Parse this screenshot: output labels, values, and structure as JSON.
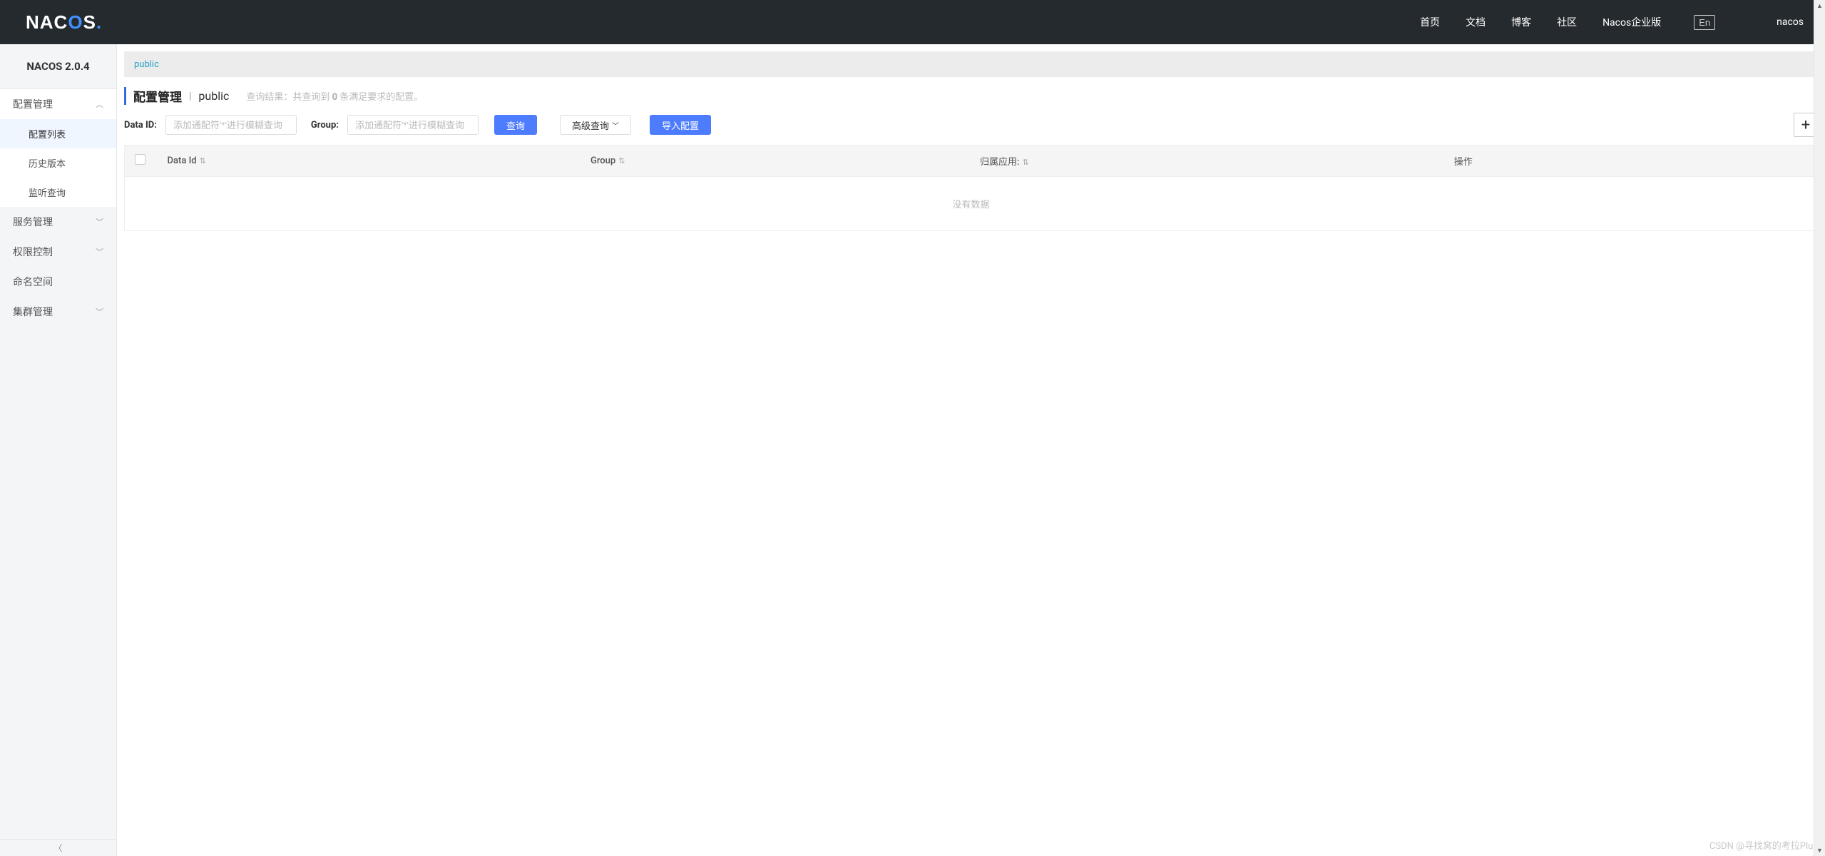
{
  "header": {
    "logo_text_1": "NAC",
    "logo_text_2": "O",
    "logo_text_3": "S",
    "nav": [
      "首页",
      "文档",
      "博客",
      "社区",
      "Nacos企业版"
    ],
    "lang": "En",
    "user": "nacos"
  },
  "sidebar": {
    "title": "NACOS 2.0.4",
    "menu": [
      {
        "label": "配置管理",
        "expanded": true,
        "children": [
          {
            "label": "配置列表",
            "active": true
          },
          {
            "label": "历史版本"
          },
          {
            "label": "监听查询"
          }
        ]
      },
      {
        "label": "服务管理",
        "arrow": true
      },
      {
        "label": "权限控制",
        "arrow": true
      },
      {
        "label": "命名空间"
      },
      {
        "label": "集群管理",
        "arrow": true
      }
    ]
  },
  "content": {
    "active_tab": "public",
    "page_title": "配置管理",
    "page_sub": "public",
    "result_prefix": "查询结果：共查询到 ",
    "result_count": "0",
    "result_suffix": " 条满足要求的配置。",
    "fields": {
      "dataid_label": "Data ID:",
      "dataid_placeholder": "添加通配符'*'进行模糊查询",
      "group_label": "Group:",
      "group_placeholder": "添加通配符'*'进行模糊查询"
    },
    "buttons": {
      "search": "查询",
      "advanced": "高级查询",
      "import": "导入配置"
    },
    "table": {
      "columns": [
        "Data Id",
        "Group",
        "归属应用:",
        "操作"
      ],
      "empty": "没有数据"
    }
  },
  "watermark": "CSDN @寻找窝的考拉Plus"
}
